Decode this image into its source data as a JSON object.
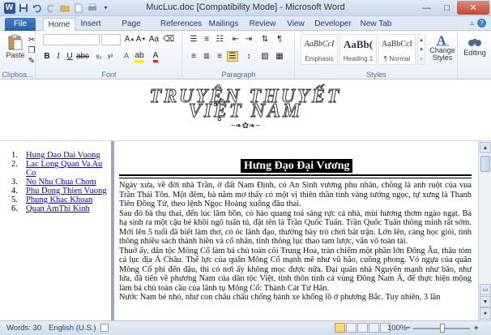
{
  "window": {
    "title": "MucLuc.doc [Compatibility Mode] - Microsoft Word"
  },
  "tabs": [
    {
      "label": "File"
    },
    {
      "label": "Home"
    },
    {
      "label": "Insert"
    },
    {
      "label": "Page Layout"
    },
    {
      "label": "References"
    },
    {
      "label": "Mailings"
    },
    {
      "label": "Review"
    },
    {
      "label": "View"
    },
    {
      "label": "Developer"
    },
    {
      "label": "New Tab"
    }
  ],
  "ribbon": {
    "clipboard": {
      "paste_label": "Paste",
      "group_label": "Clipboa..."
    },
    "font": {
      "group_label": "Font",
      "font_name": "",
      "font_size": ""
    },
    "paragraph": {
      "group_label": "Paragraph"
    },
    "styles": {
      "group_label": "Styles",
      "items": [
        {
          "sample": "AaBbCcI",
          "name": "Emphasis"
        },
        {
          "sample": "AaBb(",
          "name": "Heading 1"
        },
        {
          "sample": "AaBbCcI",
          "name": "¶ Normal"
        }
      ],
      "change_styles_label": "Change Styles"
    },
    "editing": {
      "label": "Editing"
    }
  },
  "header_art": {
    "line1": "TRUYỆN THUYẾT",
    "line2": "VIỆT NAM",
    "ornament": "~❧✿❧~"
  },
  "toc": [
    {
      "num": "1.",
      "label": "Hung Dao Dai Vuong"
    },
    {
      "num": "2.",
      "label": "Lac Long Quan Va Au Co"
    },
    {
      "num": "3.",
      "label": "No Nhu Chua Chom"
    },
    {
      "num": "4.",
      "label": "Phu Dong Thien Vuong"
    },
    {
      "num": "5.",
      "label": "Phung Khac Khoan"
    },
    {
      "num": "6.",
      "label": "Quan AmThi Kinh"
    }
  ],
  "document": {
    "title": "Hưng Đạo Đại Vương",
    "paragraphs": [
      "Ngày xưa, về đời nhà Trần, ở đất Nam Định, có An Sinh vương phu nhân, chồng là anh ruột của vua Trần Thái Tôn. Một đêm, bà nằm mơ thấy có một vị thiên thần tính vàng tướng ngọc, tự xưng là Thanh Tiên Đồng Tử, theo lệnh Ngọc Hoàng xuống đầu thai.",
      "Sau đó bà thụ thai, đến lúc lâm bồn, có hào quang toả sáng rực cả nhà, mùi hương thơm ngào ngạt. Bà hạ sinh ra một cậu bé khôi ngô tuấn tú, đặt tên là Trần Quốc Tuấn. Trần Quốc Tuấn thông minh rất sớm. Mới lên 5 tuổi đã biết làm thơ, có óc lãnh đạo, thường bày trò chơi bát trận. Lớn lên, càng học giỏi, tinh thông nhiều sách thánh hiền và cổ nhân, tinh thông lục thao tam lược, văn võ toàn tài.",
      "Thuở ấy, dân tộc Mông Cổ làm bá chủ toàn cõi Trung Hoa, tràn chiếm một phần lớn Đông Âu, thâu tóm cả lục địa Á Châu. Thế lực của quân Mông Cổ mạnh mẽ như vũ bão, cuồng phong. Vó ngựa của quân Mông Cổ phi đến đâu, thì cỏ nơi ấy không mọc được nữa. Đại quân nhà Nguyên mạnh như bão, như lửa, đã tiến về phương Nam của dân tộc Việt, tỉnh thôn tính cả vùng Đông Nam Á, để thực hiện mộng làm bá chủ toàn cầu của lãnh tụ Mông Cổ: Thành Cát Tư Hãn.",
      "Nước Nam bé nhỏ, như con châu chấu chống bánh xe khổng lồ ở phương Bắc. Tuy nhiên, 3 lần"
    ]
  },
  "statusbar": {
    "words": "Words: 30",
    "language": "English (U.S.)",
    "zoom": "100%",
    "zoom_minus": "−",
    "zoom_plus": "+"
  }
}
